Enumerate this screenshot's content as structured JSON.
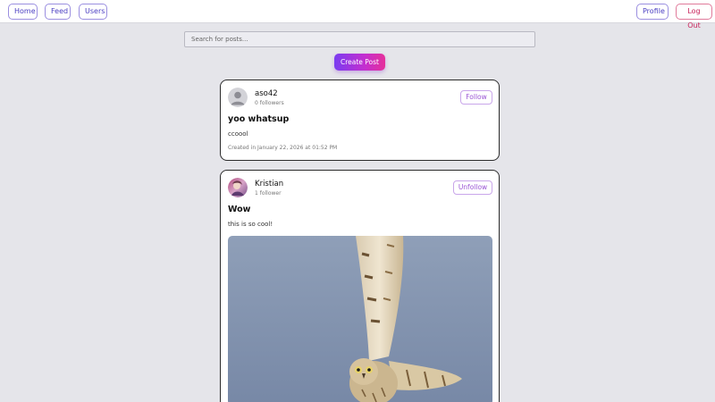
{
  "nav": {
    "home_label": "Home",
    "feed_label": "Feed",
    "users_label": "Users",
    "profile_label": "Profile",
    "logout_label": "Log Out"
  },
  "search": {
    "placeholder": "Search for posts..."
  },
  "create_post_label": "Create Post",
  "posts": [
    {
      "author": "aso42",
      "followers": "0 followers",
      "follow_label": "Follow",
      "title": "yoo whatsup",
      "body": "ccoool",
      "created": "Created in January 22, 2026 at 01:52 PM",
      "avatar": "default-avatar-icon"
    },
    {
      "author": "Kristian",
      "followers": "1 follower",
      "follow_label": "Unfollow",
      "title": "Wow",
      "body": "this is so cool!",
      "avatar": "user-photo-avatar",
      "image": "owl-in-flight-photo"
    }
  ],
  "colors": {
    "accent_purple": "#7a3cf0",
    "accent_pink": "#e5309a",
    "logout_red": "#c9245b",
    "background": "#e5e5ea"
  }
}
